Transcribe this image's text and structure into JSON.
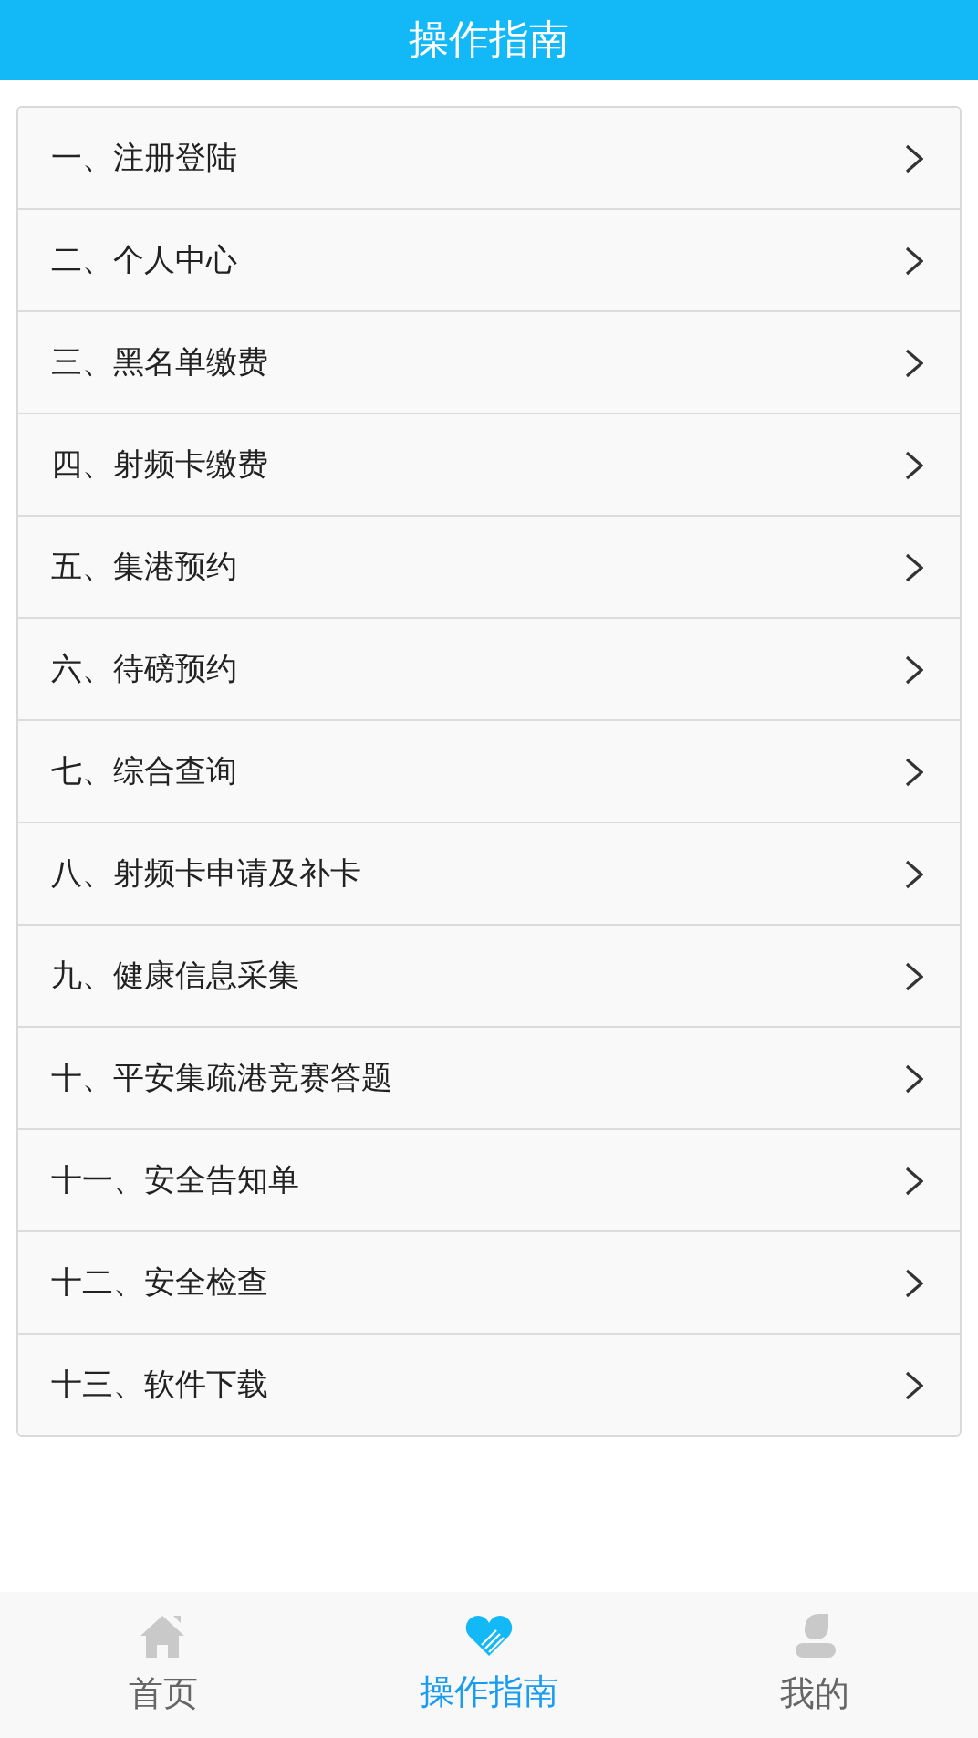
{
  "header": {
    "title": "操作指南"
  },
  "guide_items": [
    {
      "label": "一、注册登陆"
    },
    {
      "label": "二、个人中心"
    },
    {
      "label": "三、黑名单缴费"
    },
    {
      "label": "四、射频卡缴费"
    },
    {
      "label": "五、集港预约"
    },
    {
      "label": "六、待磅预约"
    },
    {
      "label": "七、综合查询"
    },
    {
      "label": "八、射频卡申请及补卡"
    },
    {
      "label": "九、健康信息采集"
    },
    {
      "label": "十、平安集疏港竞赛答题"
    },
    {
      "label": "十一、安全告知单"
    },
    {
      "label": "十二、安全检查"
    },
    {
      "label": "十三、软件下载"
    }
  ],
  "tab_bar": [
    {
      "label": "首页",
      "selected": false
    },
    {
      "label": "操作指南",
      "selected": true
    },
    {
      "label": "我的",
      "selected": false
    }
  ]
}
